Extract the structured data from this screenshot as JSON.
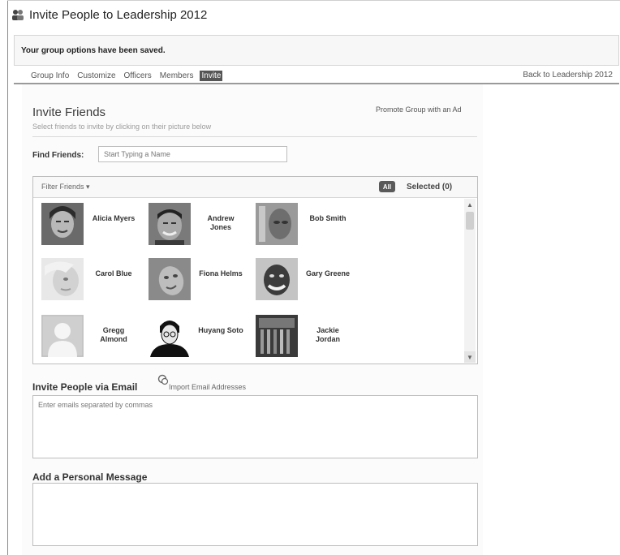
{
  "header": {
    "title": "Invite People to Leadership 2012"
  },
  "notice": {
    "text": "Your group options have been saved."
  },
  "tabs": [
    {
      "label": "Group Info"
    },
    {
      "label": "Customize"
    },
    {
      "label": "Officers"
    },
    {
      "label": "Members"
    },
    {
      "label": "Invite",
      "active": true
    }
  ],
  "back_link": "Back to Leadership 2012",
  "invite": {
    "title": "Invite Friends",
    "subtitle": "Select friends to invite by clicking on their picture below",
    "promote": "Promote Group with an Ad",
    "find_label": "Find Friends:",
    "find_placeholder": "Start Typing a Name",
    "filter_label": "Filter Friends ▾",
    "all_label": "All",
    "selected_label": "Selected (0)",
    "friends": [
      {
        "name": "Alicia Myers"
      },
      {
        "name": "Andrew Jones"
      },
      {
        "name": "Bob Smith"
      },
      {
        "name": "Carol Blue"
      },
      {
        "name": "Fiona Helms"
      },
      {
        "name": "Gary Greene"
      },
      {
        "name": "Gregg Almond"
      },
      {
        "name": "Huyang Soto"
      },
      {
        "name": "Jackie Jordan"
      }
    ]
  },
  "email": {
    "title": "Invite People via Email",
    "import_label": "Import Email Addresses",
    "placeholder": "Enter emails separated by commas"
  },
  "message": {
    "title": "Add a Personal Message"
  }
}
